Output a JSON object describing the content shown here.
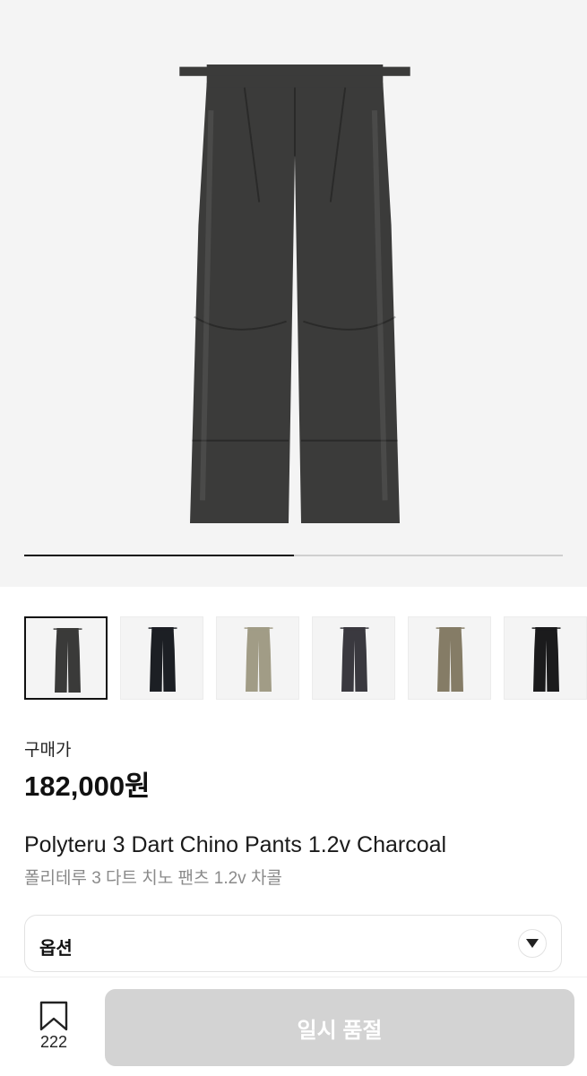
{
  "gallery": {
    "progress_fraction": 0.5,
    "main_pants_color": "#3b3b3a",
    "thumbnails": [
      {
        "color": "#3a3a39",
        "selected": true
      },
      {
        "color": "#1c1f24",
        "selected": false
      },
      {
        "color": "#a19c86",
        "selected": false
      },
      {
        "color": "#3a393f",
        "selected": false
      },
      {
        "color": "#857c66",
        "selected": false
      },
      {
        "color": "#1b1b1c",
        "selected": false
      }
    ]
  },
  "product": {
    "price_label": "구매가",
    "price": "182,000원",
    "name_en": "Polyteru 3 Dart Chino Pants 1.2v Charcoal",
    "name_ko": "폴리테루 3 다트 치노 팬츠 1.2v 차콜"
  },
  "options": {
    "label": "옵션"
  },
  "bottom_bar": {
    "bookmark_count": "222",
    "buy_button_label": "일시 품절"
  }
}
